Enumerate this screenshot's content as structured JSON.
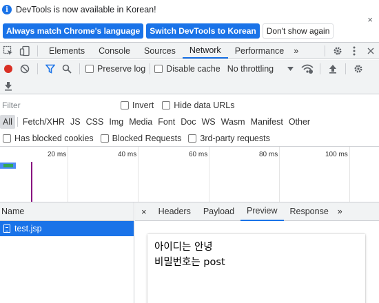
{
  "infobar": {
    "message": "DevTools is now available in Korean!",
    "buttons": [
      "Always match Chrome's language",
      "Switch DevTools to Korean",
      "Don't show again"
    ],
    "close": "×"
  },
  "tabs": [
    "Elements",
    "Console",
    "Sources",
    "Network",
    "Performance"
  ],
  "active_tab": "Network",
  "more_tabs": "»",
  "toolbar": {
    "preserve_log": "Preserve log",
    "disable_cache": "Disable cache",
    "throttling": "No throttling"
  },
  "filter": {
    "placeholder": "Filter",
    "invert": "Invert",
    "hide_data_urls": "Hide data URLs"
  },
  "types": [
    "All",
    "Fetch/XHR",
    "JS",
    "CSS",
    "Img",
    "Media",
    "Font",
    "Doc",
    "WS",
    "Wasm",
    "Manifest",
    "Other"
  ],
  "blocked": {
    "has_blocked_cookies": "Has blocked cookies",
    "blocked_requests": "Blocked Requests",
    "third_party": "3rd-party requests"
  },
  "overview": {
    "labels": [
      "20 ms",
      "40 ms",
      "60 ms",
      "80 ms",
      "100 ms"
    ]
  },
  "requests": {
    "header": "Name",
    "rows": [
      "test.jsp"
    ]
  },
  "detail": {
    "close": "×",
    "tabs": [
      "Headers",
      "Payload",
      "Preview",
      "Response"
    ],
    "active_tab": "Preview",
    "more": "»",
    "preview_lines": [
      "아이디는 안녕",
      "비밀번호는 post"
    ]
  }
}
